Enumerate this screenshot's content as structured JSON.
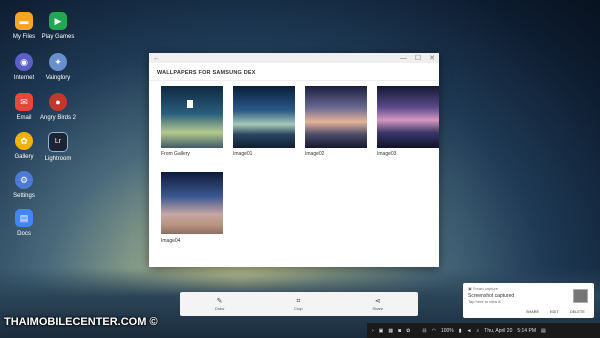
{
  "desktop": {
    "icons": [
      {
        "label": "My Files",
        "icon": "folder-icon",
        "color": "#f5a623"
      },
      {
        "label": "Play Games",
        "icon": "play-games-icon",
        "color": "#24a656"
      },
      {
        "label": "Internet",
        "icon": "internet-icon",
        "color": "#5b5fc7"
      },
      {
        "label": "Vainglory",
        "icon": "vainglory-icon",
        "color": "#6a8fcf"
      },
      {
        "label": "Email",
        "icon": "email-icon",
        "color": "#e8453c"
      },
      {
        "label": "Angry Birds 2",
        "icon": "angry-birds-icon",
        "color": "#c4372d"
      },
      {
        "label": "Gallery",
        "icon": "gallery-icon",
        "color": "#f0b400"
      },
      {
        "label": "Lightroom",
        "icon": "lightroom-icon",
        "color": "#1c2433"
      },
      {
        "label": "Settings",
        "icon": "gear-icon",
        "color": "#4b7bd6"
      },
      {
        "label": "Docs",
        "icon": "docs-icon",
        "color": "#4285f4"
      }
    ]
  },
  "window": {
    "title": "WALLPAPERS FOR SAMSUNG DEX",
    "back_glyph": "←",
    "minimize_glyph": "—",
    "maximize_glyph": "☐",
    "close_glyph": "✕",
    "wallpapers": [
      {
        "label": "From Gallery"
      },
      {
        "label": "Image01"
      },
      {
        "label": "Image02"
      },
      {
        "label": "Image03"
      },
      {
        "label": "Image04"
      }
    ]
  },
  "toolbar": {
    "buttons": [
      {
        "label": "Draw",
        "icon": "pen-icon"
      },
      {
        "label": "Crop",
        "icon": "crop-icon"
      },
      {
        "label": "Share",
        "icon": "share-icon"
      }
    ]
  },
  "notification": {
    "app": "Smart capture",
    "title": "Screenshot captured",
    "body": "Tap here to view it.",
    "actions": [
      "SHARE",
      "EDIT",
      "DELETE"
    ]
  },
  "taskbar": {
    "battery": "100%",
    "datetime": "Thu, April 20",
    "time": "5:14 PM"
  },
  "watermark": "THAIMOBILECENTER.COM ©"
}
